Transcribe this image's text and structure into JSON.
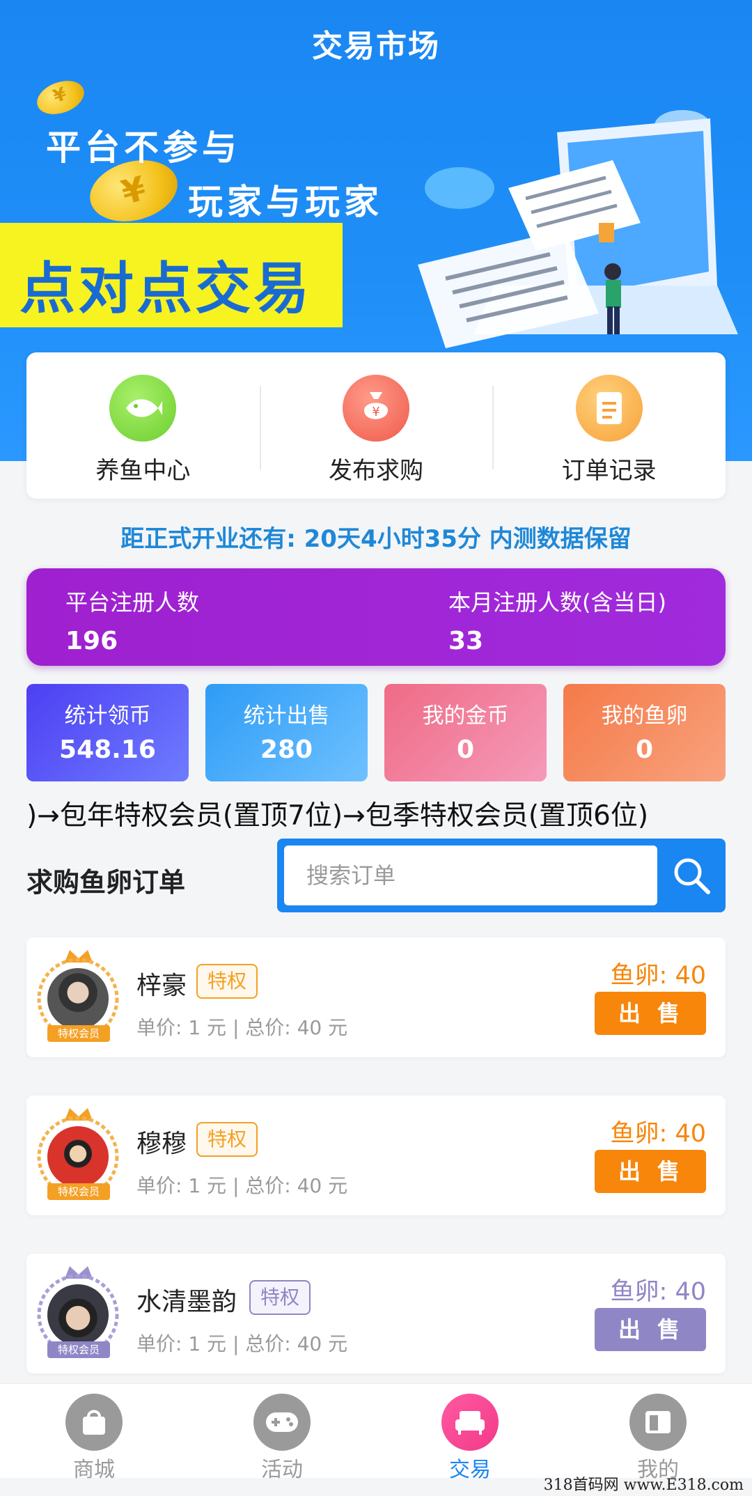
{
  "header": {
    "title": "交易市场"
  },
  "banner": {
    "slogan_line1": "平台不参与",
    "slogan_line2": "玩家与玩家",
    "headline": "点对点交易"
  },
  "quick_actions": [
    {
      "label": "养鱼中心",
      "icon": "fish-icon",
      "color": "#7dd63a"
    },
    {
      "label": "发布求购",
      "icon": "money-bag-icon",
      "color": "#f46b5c"
    },
    {
      "label": "订单记录",
      "icon": "document-icon",
      "color": "#f7a640"
    }
  ],
  "countdown": "距正式开业还有: 20天4小时35分  内测数据保留",
  "registration": {
    "platform_label": "平台注册人数",
    "platform_value": "196",
    "month_label": "本月注册人数(含当日)",
    "month_value": "33"
  },
  "stats": [
    {
      "label": "统计领币",
      "value": "548.16"
    },
    {
      "label": "统计出售",
      "value": "280"
    },
    {
      "label": "我的金币",
      "value": "0"
    },
    {
      "label": "我的鱼卵",
      "value": "0"
    }
  ],
  "marquee": ")→包年特权会员(置顶7位)→包季特权会员(置顶6位)",
  "orders_section": {
    "title": "求购鱼卵订单",
    "search_placeholder": "搜索订单"
  },
  "orders": [
    {
      "name": "梓豪",
      "tag": "特权",
      "badge": "特权会员",
      "price": "单价: 1 元 | 总价: 40 元",
      "eggs": "鱼卵: 40",
      "sell": "出售",
      "accent": "#f7860b"
    },
    {
      "name": "穆穆",
      "tag": "特权",
      "badge": "特权会员",
      "price": "单价: 1 元 | 总价: 40 元",
      "eggs": "鱼卵: 40",
      "sell": "出售",
      "accent": "#f7860b"
    },
    {
      "name": "水清墨韵",
      "tag": "特权",
      "badge": "特权会员",
      "price": "单价: 1 元 | 总价: 40 元",
      "eggs": "鱼卵: 40",
      "sell": "出售",
      "accent": "#8f86c6"
    }
  ],
  "tabbar": [
    {
      "label": "商城",
      "icon": "shopping-bag-icon",
      "active": false
    },
    {
      "label": "活动",
      "icon": "gamepad-icon",
      "active": false
    },
    {
      "label": "交易",
      "icon": "sofa-icon",
      "active": true
    },
    {
      "label": "我的",
      "icon": "user-card-icon",
      "active": false
    }
  ],
  "watermark": "318首码网 www.E318.com"
}
